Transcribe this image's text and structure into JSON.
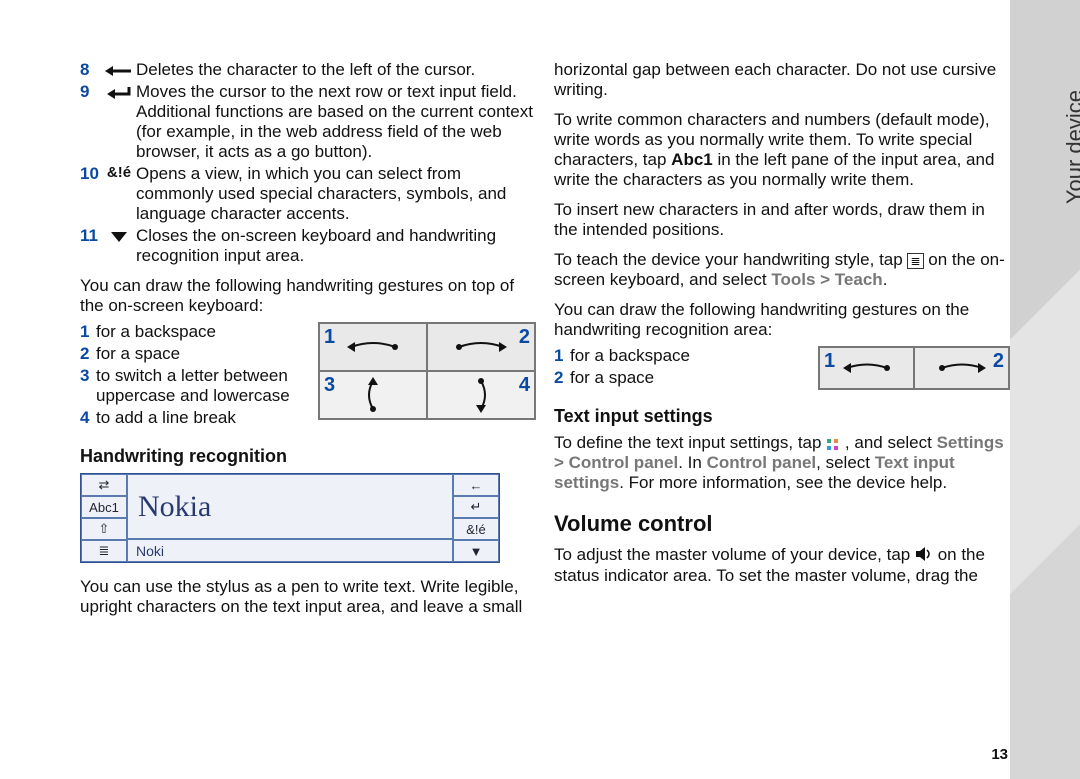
{
  "side_label": "Your device",
  "page_number": "13",
  "left": {
    "items": [
      {
        "n": "8",
        "text": "Deletes the character to the left of the cursor."
      },
      {
        "n": "9",
        "text": "Moves the cursor to the next row or text input field. Additional functions are based on the current context (for example, in the web address field of the web browser, it acts as a go button)."
      },
      {
        "n": "10",
        "text": "Opens a view, in which you can select from commonly used special characters, symbols, and language character accents."
      },
      {
        "n": "11",
        "text": "Closes the on-screen keyboard and handwriting recognition input area."
      }
    ],
    "icon10": "&!é",
    "gest_intro": "You can draw the following handwriting gestures on top of the on-screen keyboard:",
    "gestures": [
      {
        "n": "1",
        "text": "for a backspace"
      },
      {
        "n": "2",
        "text": "for a space"
      },
      {
        "n": "3",
        "text": "to switch a letter between uppercase and lowercase"
      },
      {
        "n": "4",
        "text": "to add a line break"
      }
    ],
    "fig_nums": {
      "a": "1",
      "b": "2",
      "c": "3",
      "d": "4"
    },
    "hw_heading": "Handwriting recognition",
    "hw_sample": "Nokia",
    "hw_left_labels": [
      "⇄",
      "Abc1",
      "⇧",
      "≣"
    ],
    "hw_right_labels": [
      "←",
      "↵",
      "&!é",
      "▼"
    ],
    "hw_cand": "Noki",
    "hw_para": "You can use the stylus as a pen to write text. Write legible, upright characters on the text input area, and leave a small"
  },
  "right": {
    "top": "horizontal gap between each character. Do not use cursive writing.",
    "p2a": "To write common characters and numbers (default mode), write words as you normally write them. To write special characters, tap ",
    "abc": "Abc1",
    "p2b": " in the left pane of the input area, and write the characters as you normally write them.",
    "p3": "To insert new characters in and after words, draw them in the intended positions.",
    "p4a": "To teach the device your handwriting style, tap ",
    "p4b": " on the on-screen keyboard, and select ",
    "menu1": "Tools > Teach",
    "p5": "You can draw the following handwriting gestures on the handwriting recognition area:",
    "gestures": [
      {
        "n": "1",
        "text": "for a backspace"
      },
      {
        "n": "2",
        "text": "for a space"
      }
    ],
    "fig_nums": {
      "a": "1",
      "b": "2"
    },
    "tis_heading": "Text input settings",
    "tis_a": "To define the text input settings, tap ",
    "tis_b": ", and select ",
    "tis_path1": "Settings > Control panel",
    "tis_mid": ". In ",
    "tis_cp": "Control panel",
    "tis_c": ", select ",
    "tis_path2": "Text input settings",
    "tis_end": ". For more information, see the device help.",
    "vol_heading": "Volume control",
    "vol_a": "To adjust the master volume of your device, tap ",
    "vol_b": " on the status indicator area. To set the master volume, drag the"
  }
}
